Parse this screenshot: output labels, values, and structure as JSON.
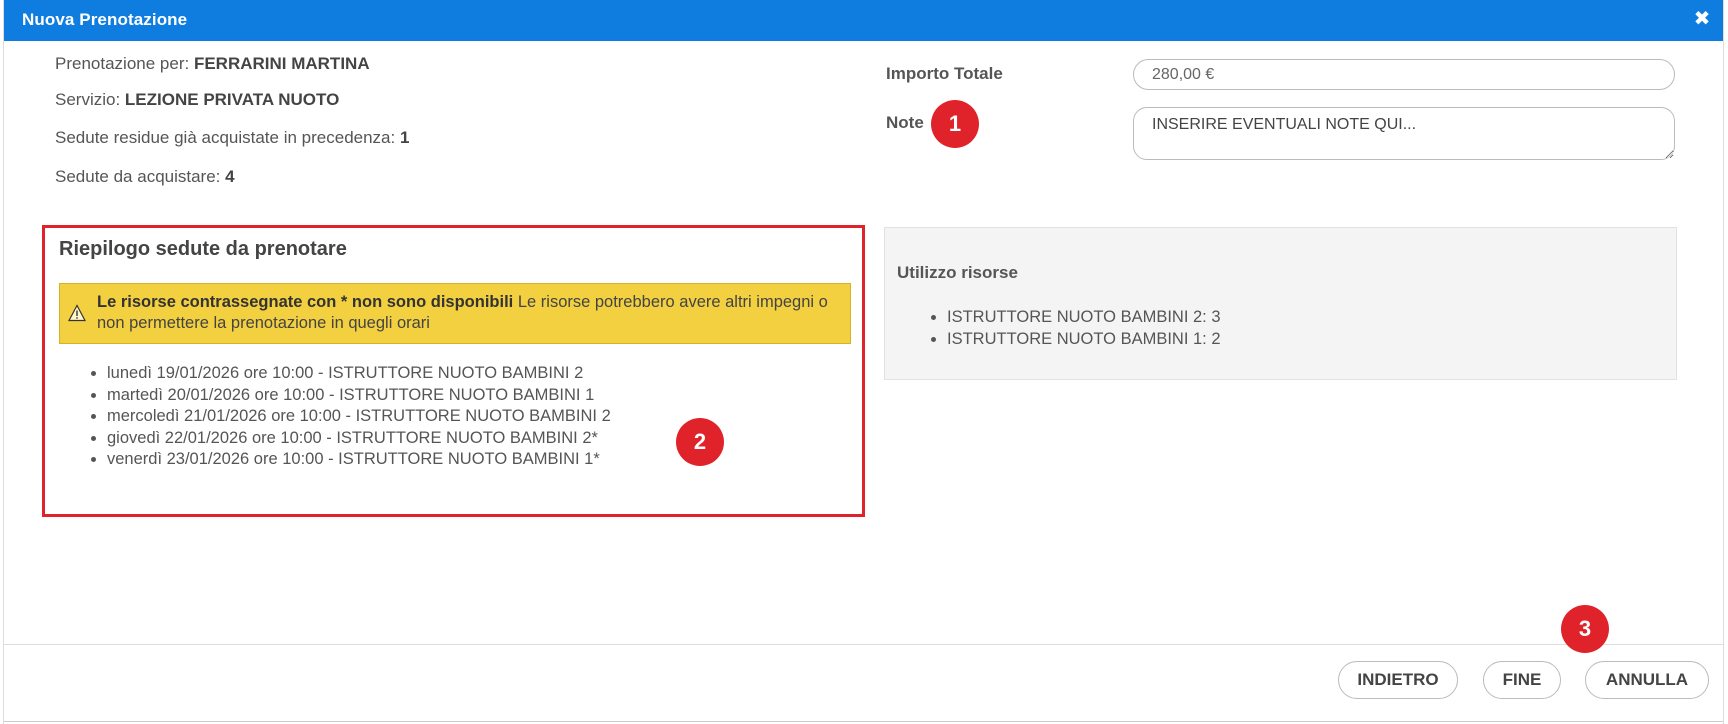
{
  "window": {
    "title": "Nuova Prenotazione"
  },
  "info": {
    "booking_for_label": "Prenotazione per:",
    "booking_for_value": "FERRARINI MARTINA",
    "service_label": "Servizio:",
    "service_value": "LEZIONE PRIVATA NUOTO",
    "remaining_label": "Sedute residue già acquistate in precedenza:",
    "remaining_value": "1",
    "to_buy_label": "Sedute da acquistare:",
    "to_buy_value": "4"
  },
  "form": {
    "total_label": "Importo Totale",
    "total_value": "280,00 €",
    "note_label": "Note",
    "note_placeholder": "INSERIRE EVENTUALI NOTE QUI..."
  },
  "summary": {
    "title": "Riepilogo sedute da prenotare",
    "warning_bold": "Le risorse contrassegnate con * non sono disponibili",
    "warning_text": "Le risorse potrebbero avere altri impegni o non permettere la prenotazione in quegli orari",
    "sessions": [
      "lunedì 19/01/2026 ore 10:00 - ISTRUTTORE NUOTO BAMBINI 2",
      "martedì 20/01/2026 ore 10:00 - ISTRUTTORE NUOTO BAMBINI 1",
      "mercoledì 21/01/2026 ore 10:00 - ISTRUTTORE NUOTO BAMBINI 2",
      "giovedì 22/01/2026 ore 10:00 - ISTRUTTORE NUOTO BAMBINI 2*",
      "venerdì 23/01/2026 ore 10:00 - ISTRUTTORE NUOTO BAMBINI 1*"
    ]
  },
  "resources": {
    "title": "Utilizzo risorse",
    "items": [
      "ISTRUTTORE NUOTO BAMBINI 2: 3",
      "ISTRUTTORE NUOTO BAMBINI 1: 2"
    ]
  },
  "badges": {
    "one": "1",
    "two": "2",
    "three": "3"
  },
  "buttons": {
    "back": "INDIETRO",
    "finish": "FINE",
    "cancel": "ANNULLA"
  },
  "colors": {
    "titlebar": "#0f7ddf",
    "highlight": "#e0232a",
    "warning_bg": "#f3d040"
  },
  "icons": {
    "close": "close-icon",
    "warning": "warning-icon"
  }
}
